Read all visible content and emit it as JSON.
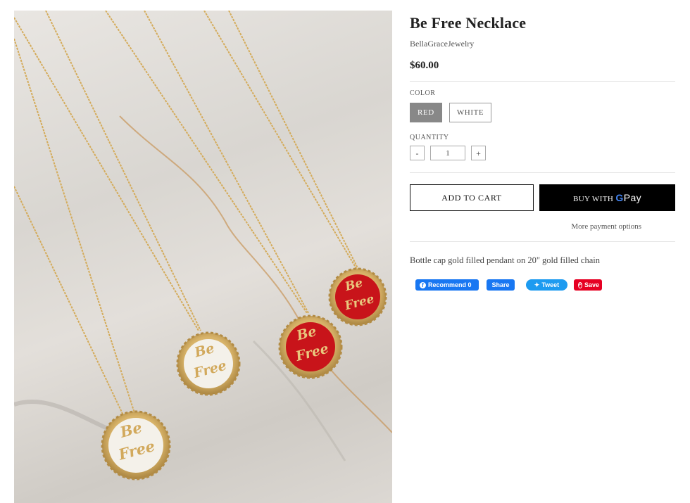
{
  "product": {
    "title": "Be Free Necklace",
    "vendor": "BellaGraceJewelry",
    "price": "$60.00",
    "description": "Bottle cap gold filled pendant on 20\" gold filled chain"
  },
  "image": {
    "pendant_text_line1": "Be",
    "pendant_text_line2": "Free"
  },
  "options": {
    "color_label": "COLOR",
    "colors": [
      "RED",
      "WHITE"
    ],
    "selected_color": "RED",
    "quantity_label": "QUANTITY",
    "quantity": "1",
    "minus": "-",
    "plus": "+"
  },
  "buttons": {
    "add_to_cart": "ADD TO CART",
    "buy_with": "BUY WITH",
    "gpay_g": "G",
    "gpay_pay": "Pay",
    "more_payment": "More payment options"
  },
  "social": {
    "recommend": "Recommend 0",
    "share": "Share",
    "tweet": "Tweet",
    "save": "Save"
  },
  "colors": {
    "red_enamel": "#c8141a",
    "white_enamel": "#f4f1ea",
    "gold": "#d8b46a",
    "facebook": "#1877f2",
    "twitter": "#1d9bf0",
    "pinterest": "#e60023"
  }
}
